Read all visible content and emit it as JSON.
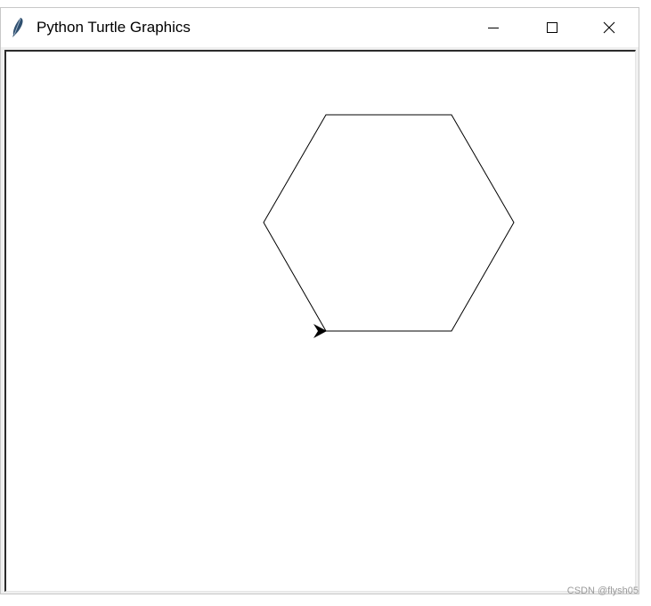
{
  "window": {
    "title": "Python Turtle Graphics",
    "icon": "feather-icon",
    "controls": {
      "minimize": "minimize-icon",
      "maximize": "maximize-icon",
      "close": "close-icon"
    }
  },
  "canvas": {
    "background": "#ffffff",
    "shape": "hexagon",
    "pen_color": "#000000",
    "turtle_icon": "turtle-arrow-icon",
    "turtle_heading": "east"
  },
  "watermark": "CSDN @flysh05"
}
